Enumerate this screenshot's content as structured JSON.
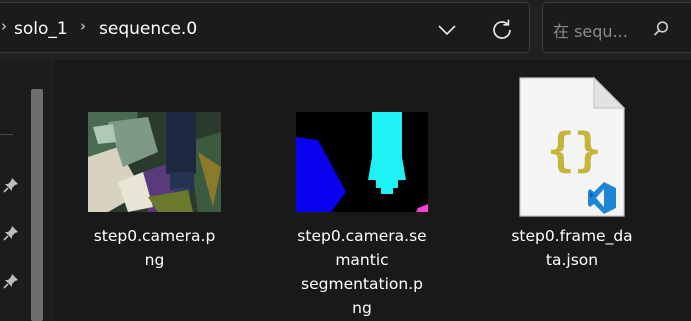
{
  "breadcrumb": {
    "items": [
      "solo_1",
      "sequence.0"
    ],
    "separator": "›"
  },
  "search": {
    "placeholder": "在 sequ..."
  },
  "icons": {
    "dropdown": "chevron-down-icon",
    "refresh": "refresh-icon",
    "search": "search-icon",
    "pin": "pin-icon",
    "json": "json-braces-icon",
    "vscode": "vscode-icon"
  },
  "files": [
    {
      "name_line1": "step0.camera.p",
      "name_line2": "ng",
      "name_line3": "",
      "name_line4": "",
      "type": "image"
    },
    {
      "name_line1": "step0.camera.se",
      "name_line2": "mantic",
      "name_line3": "segmentation.p",
      "name_line4": "ng",
      "type": "image"
    },
    {
      "name_line1": "step0.frame_da",
      "name_line2": "ta.json",
      "name_line3": "",
      "name_line4": "",
      "type": "json"
    }
  ],
  "colors": {
    "background": "#191919",
    "json_brace": "#c5b53a",
    "vscode_blue": "#1f86d6",
    "seg_cyan": "#1ef2f5",
    "seg_blue": "#0a00f0",
    "seg_pink": "#f542d7"
  }
}
